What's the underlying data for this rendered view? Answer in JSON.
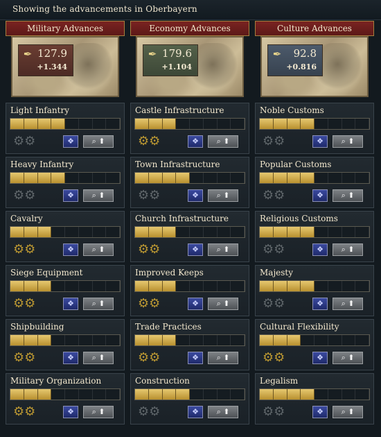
{
  "header": {
    "title": "Showing the advancements in Oberbayern"
  },
  "columns": [
    {
      "key": "mil",
      "title": "Military Advances",
      "points": "127.9",
      "rate": "+1.344",
      "icon": "quill-scroll-icon",
      "techs": [
        {
          "name": "Light Infantry",
          "filled": 4
        },
        {
          "name": "Heavy Infantry",
          "filled": 4
        },
        {
          "name": "Cavalry",
          "filled": 3
        },
        {
          "name": "Siege Equipment",
          "filled": 3
        },
        {
          "name": "Shipbuilding",
          "filled": 3
        },
        {
          "name": "Military Organization",
          "filled": 3
        }
      ]
    },
    {
      "key": "eco",
      "title": "Economy Advances",
      "points": "179.6",
      "rate": "+1.104",
      "icon": "quill-scroll-icon",
      "techs": [
        {
          "name": "Castle Infrastructure",
          "filled": 3
        },
        {
          "name": "Town Infrastructure",
          "filled": 4
        },
        {
          "name": "Church Infrastructure",
          "filled": 3
        },
        {
          "name": "Improved Keeps",
          "filled": 3
        },
        {
          "name": "Trade Practices",
          "filled": 3
        },
        {
          "name": "Construction",
          "filled": 4
        }
      ]
    },
    {
      "key": "cul",
      "title": "Culture Advances",
      "points": "92.8",
      "rate": "+0.816",
      "icon": "quill-scroll-icon",
      "techs": [
        {
          "name": "Noble Customs",
          "filled": 4
        },
        {
          "name": "Popular Customs",
          "filled": 4
        },
        {
          "name": "Religious Customs",
          "filled": 4
        },
        {
          "name": "Majesty",
          "filled": 4
        },
        {
          "name": "Cultural Flexibility",
          "filled": 3
        },
        {
          "name": "Legalism",
          "filled": 4
        }
      ]
    }
  ],
  "total_segments": 8
}
